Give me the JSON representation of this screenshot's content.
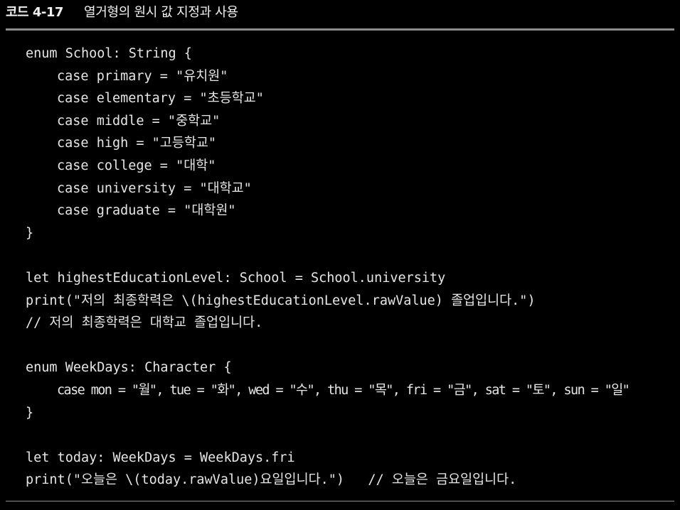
{
  "header": {
    "number": "코드 4-17",
    "title": "열거형의 원시 값 지정과 사용"
  },
  "code": {
    "lines": [
      "enum School: String {",
      "case primary = \"유치원\"",
      "case elementary = \"초등학교\"",
      "case middle = \"중학교\"",
      "case high = \"고등학교\"",
      "case college = \"대학\"",
      "case university = \"대학교\"",
      "case graduate = \"대학원\"",
      "}",
      "",
      "let highestEducationLevel: School = School.university",
      "print(\"저의 최종학력은 \\(highestEducationLevel.rawValue) 졸업입니다.\")",
      "// 저의 최종학력은 대학교 졸업입니다.",
      "",
      "enum WeekDays: Character {",
      "case mon = \"월\", tue = \"화\", wed = \"수\", thu = \"목\", fri = \"금\", sat = \"토\", sun = \"일\"",
      "}",
      "",
      "let today: WeekDays = WeekDays.fri",
      "print(\"오늘은 \\(today.rawValue)요일입니다.\")   // 오늘은 금요일입니다."
    ]
  }
}
